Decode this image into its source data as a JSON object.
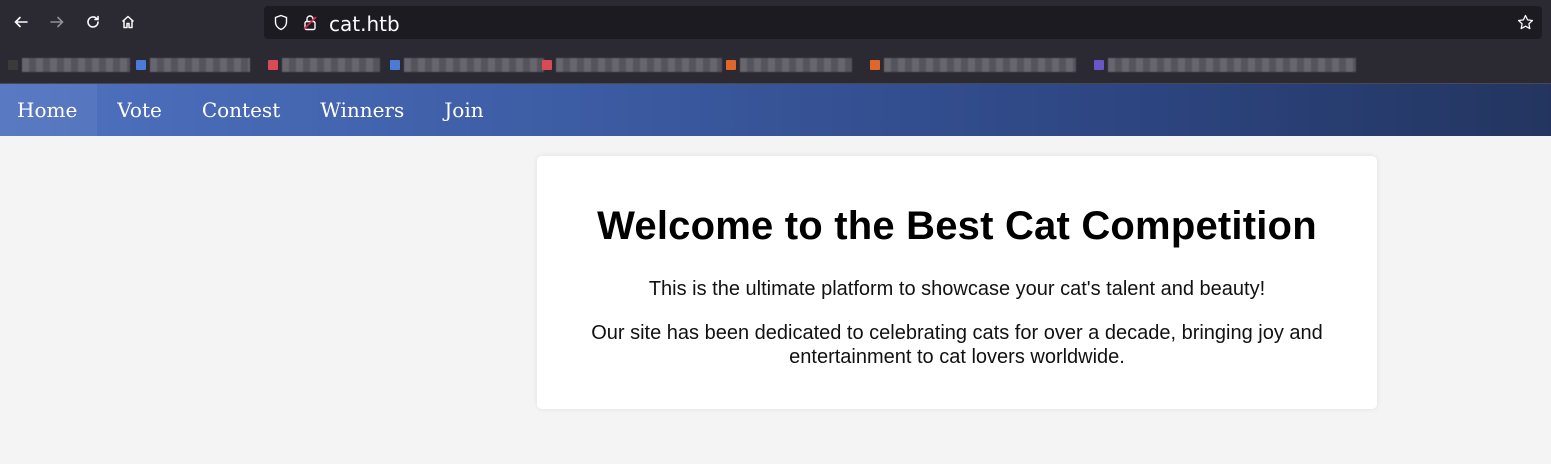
{
  "browser": {
    "url": "cat.htb",
    "bookmark_colors": [
      "#3a3a3a",
      "#4b7bd6",
      "#d84a55",
      "#4b7bd6",
      "#d84a55",
      "#e0662b",
      "#e0662b",
      "#6a56c8",
      "#7a7a82"
    ]
  },
  "nav": {
    "items": [
      "Home",
      "Vote",
      "Contest",
      "Winners",
      "Join"
    ]
  },
  "main": {
    "title": "Welcome to the Best Cat Competition",
    "intro": "This is the ultimate platform to showcase your cat's talent and beauty!",
    "about": "Our site has been dedicated to celebrating cats for over a decade, bringing joy and entertainment to cat lovers worldwide."
  },
  "colors": {
    "nav_start": "#4f72c0",
    "nav_end": "#23355f",
    "page_bg": "#f4f4f4"
  }
}
